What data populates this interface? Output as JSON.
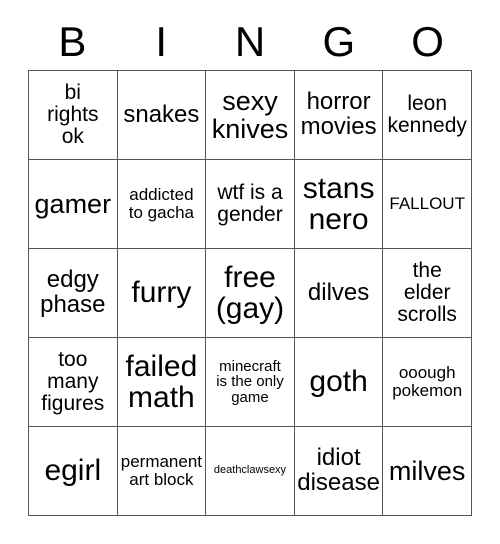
{
  "header": {
    "letters": [
      "B",
      "I",
      "N",
      "G",
      "O"
    ]
  },
  "colors": {
    "background": "#ffffff",
    "text": "#000000",
    "grid_line": "#555555"
  },
  "grid": {
    "columns": 5,
    "rows": 5,
    "cells": [
      {
        "text": "bi\nrights\nok",
        "size": "md"
      },
      {
        "text": "snakes",
        "size": "lg"
      },
      {
        "text": "sexy\nknives",
        "size": "xl"
      },
      {
        "text": "horror\nmovies",
        "size": "lg"
      },
      {
        "text": "leon\nkennedy",
        "size": "md"
      },
      {
        "text": "gamer",
        "size": "xl"
      },
      {
        "text": "addicted\nto gacha",
        "size": "sm"
      },
      {
        "text": "wtf is a\ngender",
        "size": "md"
      },
      {
        "text": "stans\nnero",
        "size": "xxl"
      },
      {
        "text": "FALLOUT",
        "size": "sm"
      },
      {
        "text": "edgy\nphase",
        "size": "lg"
      },
      {
        "text": "furry",
        "size": "xxl"
      },
      {
        "text": "free\n(gay)",
        "size": "xxl"
      },
      {
        "text": "dilves",
        "size": "lg"
      },
      {
        "text": "the\nelder\nscrolls",
        "size": "md"
      },
      {
        "text": "too\nmany\nfigures",
        "size": "md"
      },
      {
        "text": "failed\nmath",
        "size": "xxl"
      },
      {
        "text": "minecraft\nis the only\ngame",
        "size": "xs"
      },
      {
        "text": "goth",
        "size": "xxl"
      },
      {
        "text": "ooough\npokemon",
        "size": "sm"
      },
      {
        "text": "egirl",
        "size": "xxl"
      },
      {
        "text": "permanent\nart block",
        "size": "sm"
      },
      {
        "text": "deathclawsexy",
        "size": "xxs"
      },
      {
        "text": "idiot\ndisease",
        "size": "lg"
      },
      {
        "text": "milves",
        "size": "xl"
      }
    ]
  }
}
